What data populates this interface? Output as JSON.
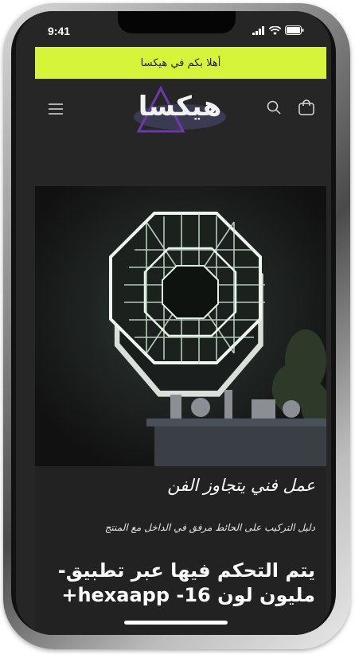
{
  "status": {
    "time": "9:41"
  },
  "announcement": {
    "text": "أهلا بكم في هيكسا"
  },
  "header": {
    "logo_text": "هيكسا",
    "menu_icon": "hamburger-menu-icon",
    "search_icon": "search-icon",
    "cart_icon": "shopping-bag-icon"
  },
  "hero": {
    "image_subject": "octagonal-infinity-mirror-illustration"
  },
  "content": {
    "heading": "عمل فني يتجاوز الفن",
    "subtext": "دليل التركيب على الحائط مرفق في الداخل مع المنتج",
    "feature_line1": "-يتم التحكم فيها عبر تطبيق",
    "feature_line2": "+hexaapp -16 مليون لون"
  },
  "colors": {
    "announcement_bg": "#d6f53a",
    "page_bg": "#222222",
    "text": "#ffffff"
  }
}
